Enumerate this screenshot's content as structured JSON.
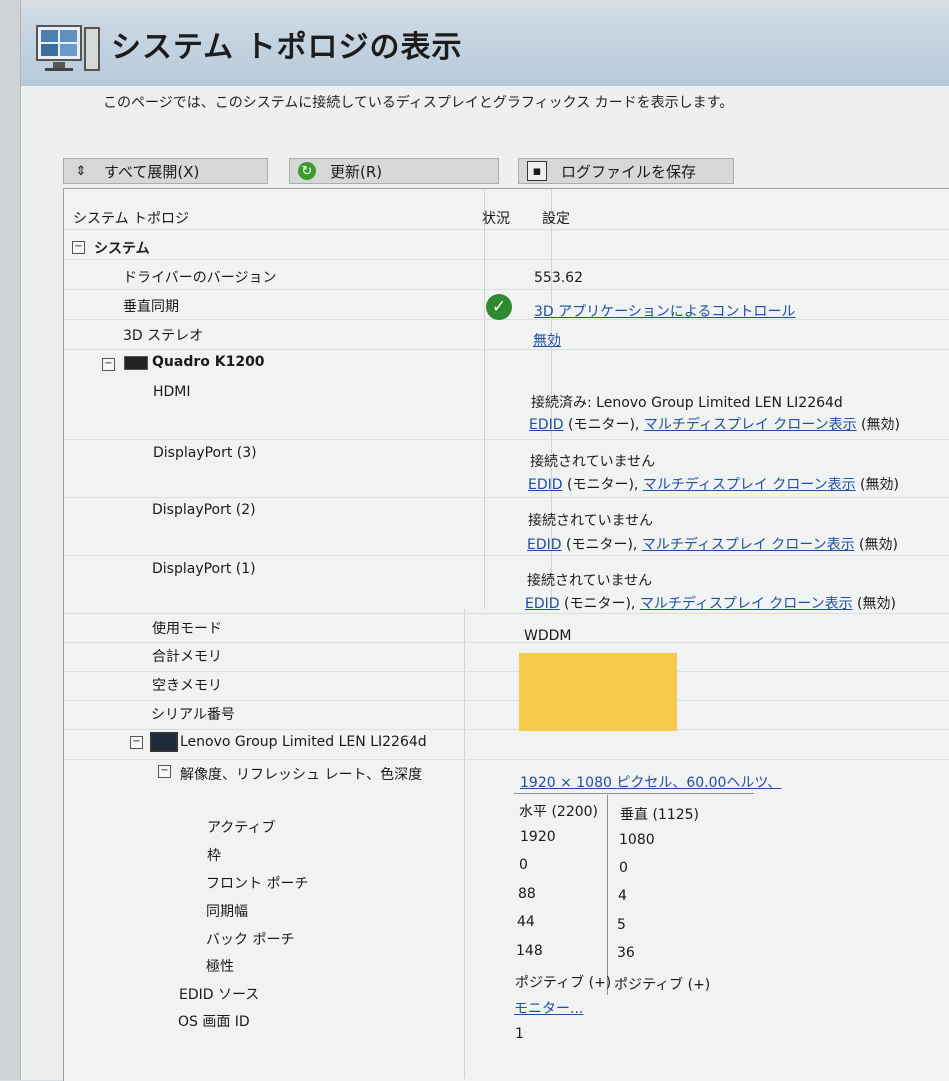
{
  "page": {
    "title": "システム トポロジの表示",
    "description": "このページでは、このシステムに接続しているディスプレイとグラフィックス カードを表示します。"
  },
  "toolbar": {
    "expand_all": "すべて展開(X)",
    "refresh": "更新(R)",
    "save_log": "ログファイルを保存"
  },
  "table": {
    "headers": {
      "topology": "システム トポロジ",
      "status": "状況",
      "settings": "設定"
    },
    "system": {
      "label": "システム",
      "driver_version_label": "ドライバーのバージョン",
      "driver_version_value": "553.62",
      "vsync_label": "垂直同期",
      "vsync_value": "3D アプリケーションによるコントロール",
      "stereo_label": "3D ステレオ",
      "stereo_value": "無効"
    },
    "gpu": {
      "name": "Quadro K1200",
      "ports": [
        {
          "label": "HDMI",
          "status": "接続済み: Lenovo Group Limited LEN LI2264d",
          "edid": "EDID",
          "middle": " (モニター), ",
          "clone": "マルチディスプレイ クローン表示",
          "tail": " (無効)"
        },
        {
          "label": "DisplayPort (3)",
          "status": "接続されていません",
          "edid": "EDID",
          "middle": " (モニター), ",
          "clone": "マルチディスプレイ クローン表示",
          "tail": " (無効)"
        },
        {
          "label": "DisplayPort (2)",
          "status": "接続されていません",
          "edid": "EDID",
          "middle": " (モニター), ",
          "clone": "マルチディスプレイ クローン表示",
          "tail": " (無効)"
        },
        {
          "label": "DisplayPort (1)",
          "status": "接続されていません",
          "edid": "EDID",
          "middle": " (モニター), ",
          "clone": "マルチディスプレイ クローン表示",
          "tail": " (無効)"
        }
      ],
      "usage_mode_label": "使用モード",
      "usage_mode_value": "WDDM",
      "total_memory_label": "合計メモリ",
      "free_memory_label": "空きメモリ",
      "serial_label": "シリアル番号",
      "redaction_color": "#f5c94a"
    },
    "monitor": {
      "name": "Lenovo Group Limited LEN LI2264d",
      "resolution_label": "解像度、リフレッシュ レート、色深度",
      "resolution_value": "1920 × 1080 ピクセル、60.00ヘルツ、",
      "timing_headers": {
        "h": "水平 (2200)",
        "v": "垂直 (1125)"
      },
      "timing_rows": [
        {
          "label": "アクティブ",
          "h": "1920",
          "v": "1080"
        },
        {
          "label": "枠",
          "h": "0",
          "v": "0"
        },
        {
          "label": "フロント ポーチ",
          "h": "88",
          "v": "4"
        },
        {
          "label": "同期幅",
          "h": "44",
          "v": "5"
        },
        {
          "label": "バック ポーチ",
          "h": "148",
          "v": "36"
        },
        {
          "label": "極性",
          "h": "ポジティブ (+)",
          "v": "ポジティブ (+)"
        }
      ],
      "edid_source_label": "EDID ソース",
      "edid_source_value": "モニター...",
      "os_screen_id_label": "OS 画面 ID",
      "os_screen_id_value": "1"
    }
  },
  "colors": {
    "link": "#1f4fa0",
    "header_bg": "#b7c9d8",
    "check": "#2f8a2f"
  }
}
